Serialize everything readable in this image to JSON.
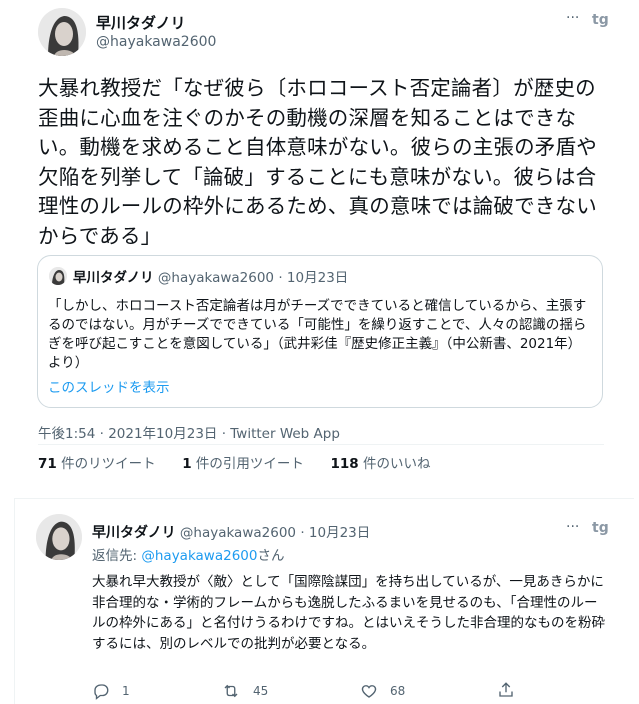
{
  "tweet": {
    "author_name": "早川タダノリ",
    "author_handle": "@hayakawa2600",
    "text": "大暴れ教授だ「なぜ彼ら〔ホロコースト否定論者〕が歴史の歪曲に心血を注ぐのかその動機の深層を知ることはできない。動機を求めること自体意味がない。彼らの主張の矛盾や欠陥を列挙して「論破」することにも意味がない。彼らは合理性のルールの枠外にあるため、真の意味では論破できないからである」",
    "timestamp": "午後1:54 · 2021年10月23日 · Twitter Web App",
    "retweets_count": "71",
    "retweets_label": "件のリツイート",
    "quotes_count": "1",
    "quotes_label": "件の引用ツイート",
    "likes_count": "118",
    "likes_label": "件のいいね"
  },
  "quoted_tweet": {
    "author_name": "早川タダノリ",
    "author_handle": "@hayakawa2600",
    "date": "10月23日",
    "text": "「しかし、ホロコースト否定論者は月がチーズでできていると確信しているから、主張するのではない。月がチーズでできている「可能性」を繰り返すことで、人々の認識の揺らぎを呼び起こすことを意図している」（武井彩佳『歴史修正主義』（中公新書、2021年）より）",
    "show_thread": "このスレッドを表示"
  },
  "reply": {
    "author_name": "早川タダノリ",
    "author_handle": "@hayakawa2600",
    "date": "10月23日",
    "reply_to_label": "返信先:",
    "reply_to_handle": "@hayakawa2600",
    "reply_to_suffix": "さん",
    "text": "大暴れ早大教授が〈敵〉として「国際陰謀団」を持ち出しているが、一見あきらかに非合理的な・学術的フレームからも逸脱したふるまいを見せるのも、「合理性のルールの枠外にある」と名付けうるわけですね。とはいえそうした非合理的なものを粉砕するには、別のレベルでの批判が必要となる。",
    "reply_count": "1",
    "retweet_count": "45",
    "like_count": "68"
  },
  "icons": [
    "more-icon",
    "tweetdeck-icon",
    "reply-icon",
    "retweet-icon",
    "like-icon",
    "share-icon"
  ],
  "colors": {
    "link": "#1d9bf0",
    "text": "#0f1419",
    "secondary": "#536471",
    "border": "#cfd9de"
  }
}
